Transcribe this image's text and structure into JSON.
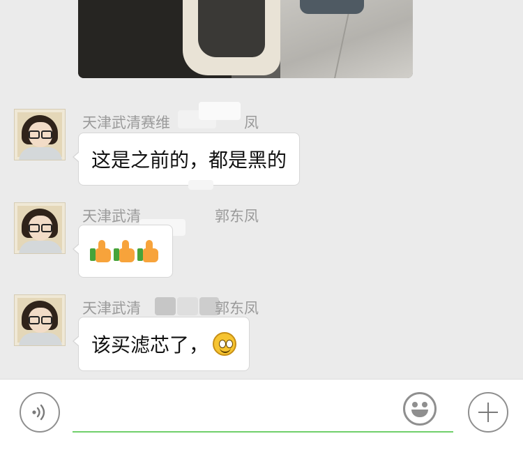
{
  "messages": [
    {
      "sender_name": "天津武清赛维",
      "sender_name_suffix": "凤",
      "text": "这是之前的，都是黑的"
    },
    {
      "sender_name": "天津武清",
      "sender_name_suffix": "郭东凤",
      "emoji": [
        "thumbs-up",
        "thumbs-up",
        "thumbs-up"
      ]
    },
    {
      "sender_name": "天津武清",
      "sender_name_suffix": "郭东凤",
      "text": "该买滤芯了，",
      "trailing_emoji": "smiley"
    }
  ],
  "input_bar": {
    "placeholder": "",
    "accent_color": "#6fcf6a",
    "icons": [
      "voice-icon",
      "emoji-icon",
      "plus-icon"
    ]
  },
  "colors": {
    "chat_background": "#ebebeb",
    "bubble": "#ffffff",
    "name_text": "#9a9a9a"
  }
}
